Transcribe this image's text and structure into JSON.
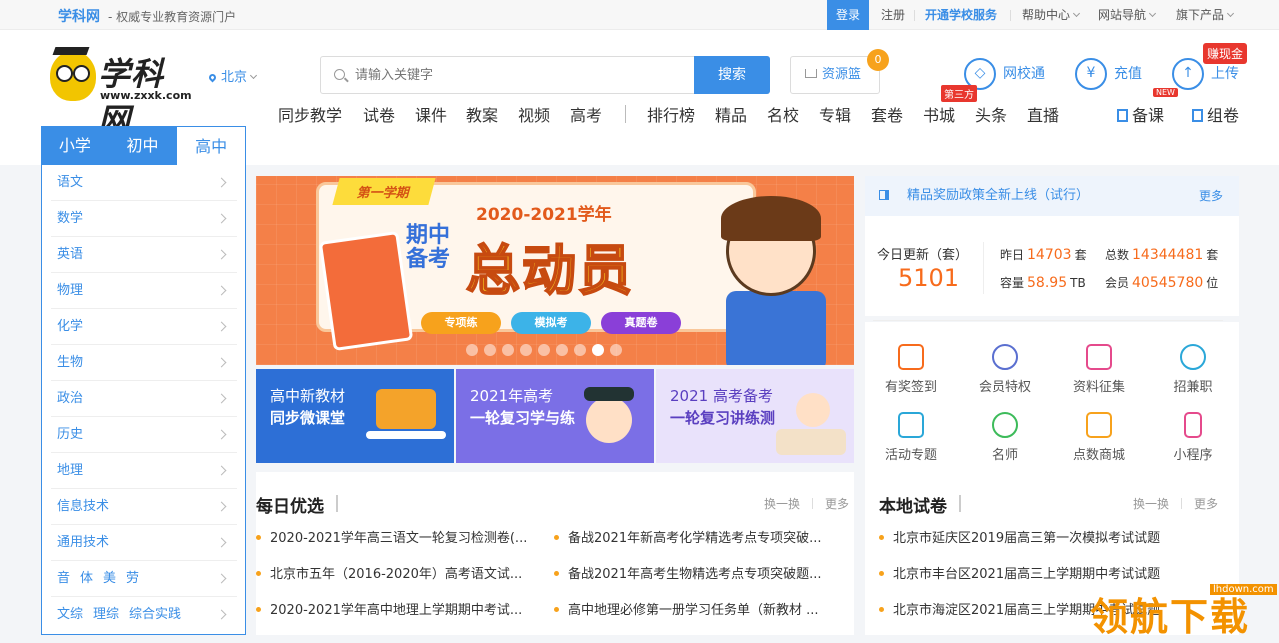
{
  "topbar": {
    "brand": "学科网",
    "slogan": "- 权威专业教育资源门户",
    "login": "登录",
    "register": "注册",
    "school_service": "开通学校服务",
    "help": "帮助中心",
    "site_nav": "网站导航",
    "products": "旗下产品"
  },
  "header": {
    "logo_name": "学科网",
    "logo_url": "www.zxxk.com",
    "location": "北京",
    "search_placeholder": "请输入关键字",
    "search_button": "搜索",
    "basket_label": "资源篮",
    "basket_count": "0",
    "school_link": "网校通",
    "recharge": "充值",
    "upload": "上传",
    "earn_badge": "赚现金"
  },
  "grade_tabs": [
    "小学",
    "初中",
    "高中"
  ],
  "nav": {
    "items": [
      "同步教学",
      "试卷",
      "课件",
      "教案",
      "视频",
      "高考",
      "排行榜",
      "精品",
      "名校",
      "专辑",
      "套卷",
      "书城",
      "头条",
      "直播"
    ],
    "third_party_badge": "第三方",
    "new_badge": "NEW",
    "prepare": "备课",
    "compose": "组卷"
  },
  "sidebar": {
    "subjects": [
      "语文",
      "数学",
      "英语",
      "物理",
      "化学",
      "生物",
      "政治",
      "历史",
      "地理",
      "信息技术",
      "通用技术"
    ],
    "row_arts": [
      "音",
      "体",
      "美",
      "劳"
    ],
    "row_combo": [
      "文综",
      "理综",
      "综合实践"
    ]
  },
  "banner": {
    "ribbon": "第一学期",
    "year": "2020-2021学年",
    "side_text": "期中备考",
    "headline": "总动员",
    "buttons": [
      "专项练",
      "模拟考",
      "真题卷"
    ],
    "button_colors": [
      "#f7a21c",
      "#3cb3e8",
      "#8a3fd8"
    ],
    "slides": 9,
    "active_slide": 8
  },
  "cards": [
    {
      "line1": "高中新教材",
      "line2": "同步微课堂",
      "bg": "#2d6fd6"
    },
    {
      "line1": "2021年高考",
      "line2": "一轮复习学与练",
      "bg": "#7b6fe6"
    },
    {
      "line1": "2021 高考备考",
      "line2": "一轮复习讲练测",
      "bg": "#e9e2fb"
    }
  ],
  "notice": {
    "text": "精品奖励政策全新上线（试行）",
    "more": "更多"
  },
  "stats": {
    "today_label": "今日更新（套）",
    "today_value": "5101",
    "yesterday_label": "昨日",
    "yesterday_value": "14703",
    "yesterday_unit": "套",
    "total_label": "总数",
    "total_value": "14344481",
    "total_unit": "套",
    "capacity_label": "容量",
    "capacity_value": "58.95",
    "capacity_unit": "TB",
    "members_label": "会员",
    "members_value": "40545780",
    "members_unit": "位"
  },
  "quick_links": [
    {
      "label": "有奖签到",
      "icon": "calendar-check-icon",
      "color": "#f76b1c"
    },
    {
      "label": "会员特权",
      "icon": "vip-icon",
      "color": "#5a6fd0"
    },
    {
      "label": "资料征集",
      "icon": "document-icon",
      "color": "#e54a8c"
    },
    {
      "label": "招兼职",
      "icon": "clock-icon",
      "color": "#2aa7d8"
    },
    {
      "label": "活动专题",
      "icon": "edit-icon",
      "color": "#2aa7d8"
    },
    {
      "label": "名师",
      "icon": "star-teacher-icon",
      "color": "#3dbb5a"
    },
    {
      "label": "点数商城",
      "icon": "shop-icon",
      "color": "#f7a21c"
    },
    {
      "label": "小程序",
      "icon": "phone-icon",
      "color": "#e54a8c"
    }
  ],
  "daily": {
    "title": "每日优选",
    "swap": "换一换",
    "more": "更多",
    "items": [
      "2020-2021学年高三语文一轮复习检测卷(...",
      "备战2021年新高考化学精选考点专项突破...",
      "北京市五年（2016-2020年）高考语文试...",
      "备战2021年高考生物精选考点专项突破题...",
      "2020-2021学年高中地理上学期期中考试...",
      "高中地理必修第一册学习任务单（新教材 ..."
    ]
  },
  "local": {
    "title": "本地试卷",
    "swap": "换一换",
    "more": "更多",
    "items": [
      "北京市延庆区2019届高三第一次模拟考试试题",
      "北京市丰台区2021届高三上学期期中考试试题",
      "北京市海淀区2021届高三上学期期中考试试题"
    ]
  },
  "watermark": {
    "text": "领航下载",
    "site": "lhdown.com"
  }
}
